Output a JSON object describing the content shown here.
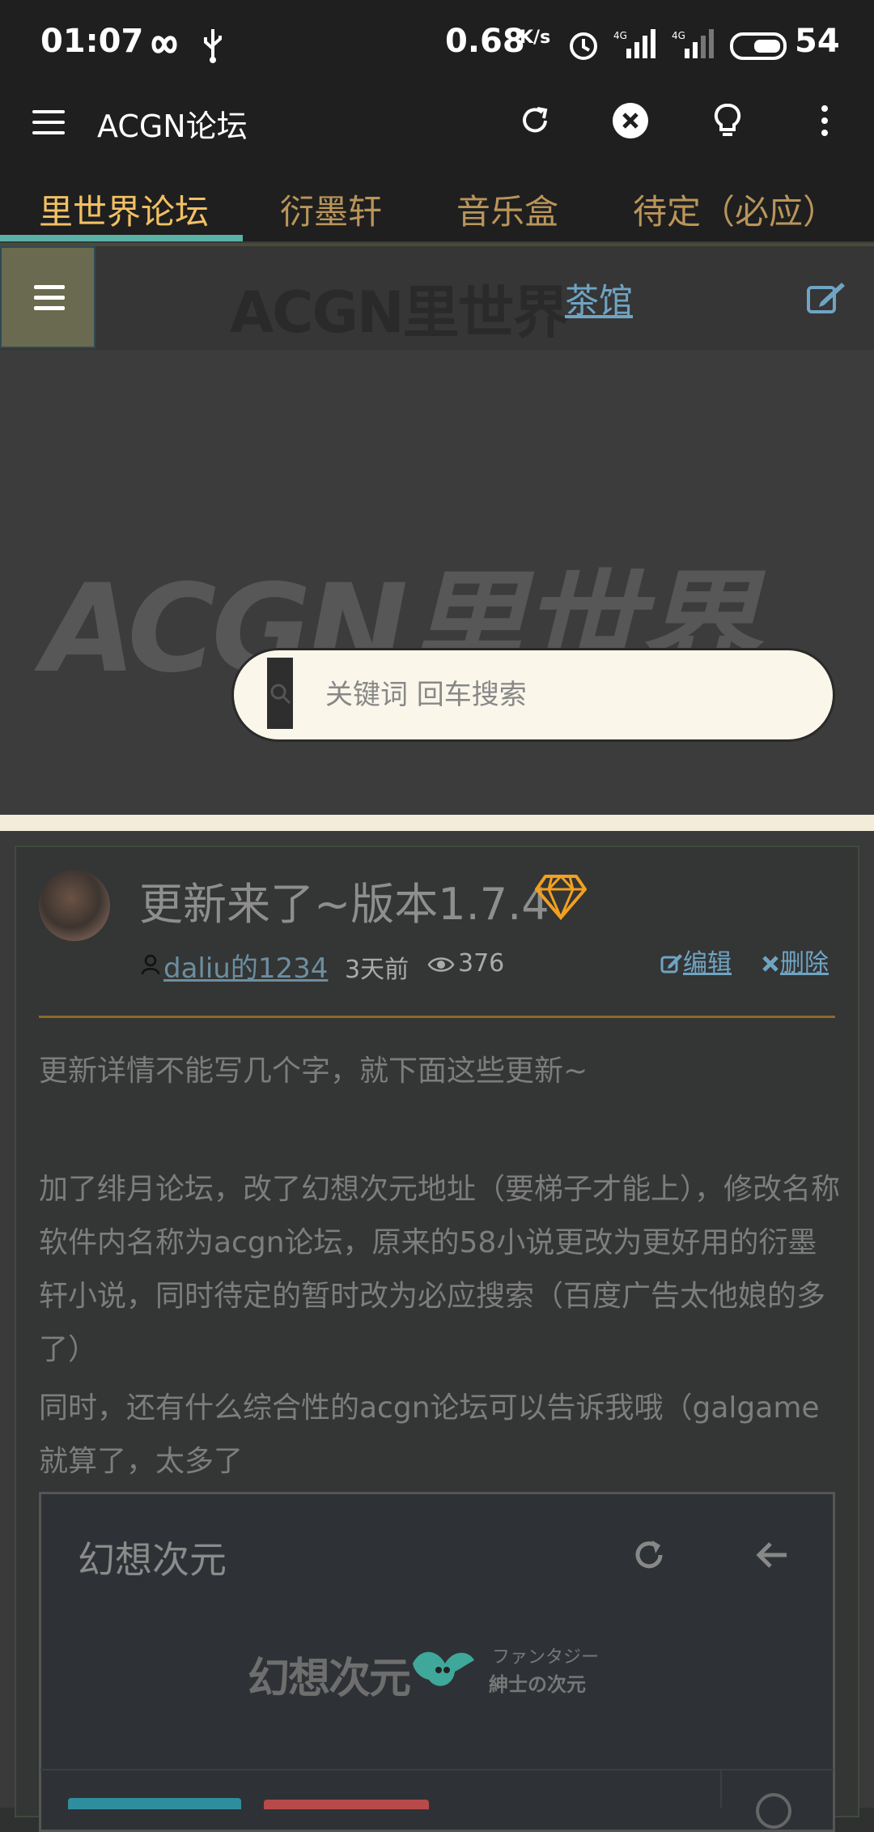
{
  "status_bar": {
    "time": "01:07",
    "network_speed": "0.68",
    "network_speed_unit": "K/s",
    "battery": "54"
  },
  "app_bar": {
    "title": "ACGN论坛"
  },
  "tabs": [
    {
      "label": "里世界论坛",
      "active": true
    },
    {
      "label": "衍墨轩",
      "active": false
    },
    {
      "label": "音乐盒",
      "active": false
    },
    {
      "label": "待定（必应）",
      "active": false
    }
  ],
  "site": {
    "logo_text": "ACGN里世界",
    "section_link": "茶馆",
    "banner_logo": "ACGN里世界",
    "search_placeholder": "关键词 回车搜索"
  },
  "post": {
    "title": "更新来了~版本1.7.4",
    "author": "daliu的1234",
    "time_ago": "3天前",
    "views": "376",
    "edit_label": "编辑",
    "delete_label": "删除",
    "paragraphs": [
      "更新详情不能写几个字，就下面这些更新~",
      "加了绯月论坛，改了幻想次元地址（要梯子才能上），修改名称软件内名称为acgn论坛，原来的58小说更改为更好用的衍墨轩小说，同时待定的暂时改为必应搜索（百度广告太他娘的多了）",
      "同时，还有什么综合性的acgn论坛可以告诉我哦（galgame就算了，太多了"
    ],
    "embed": {
      "title": "幻想次元",
      "logo_text": "幻想次元",
      "tagline_1": "ファンタジー",
      "tagline_2": "紳士の次元"
    }
  },
  "colors": {
    "accent_tab": "#f2c063",
    "tab_indicator": "#5ab1a6",
    "link": "#6fa4c3",
    "gem": "#f2a020"
  }
}
